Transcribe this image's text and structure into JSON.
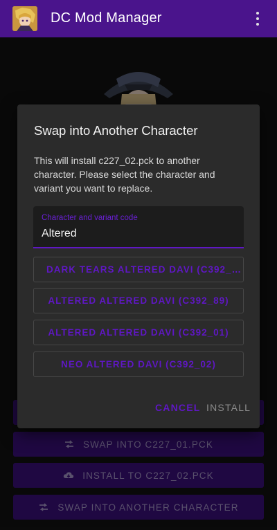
{
  "app": {
    "title": "DC Mod Manager"
  },
  "background_buttons": {
    "swap_into": "SWAP INTO C227_01.PCK",
    "install_to": "INSTALL TO C227_02.PCK",
    "swap_other": "SWAP INTO ANOTHER CHARACTER"
  },
  "dialog": {
    "title": "Swap into Another Character",
    "message": "This will install c227_02.pck to another character. Please select the character and variant you want to replace.",
    "field": {
      "label": "Character and variant code",
      "value": "Altered"
    },
    "options": [
      "DARK TEARS ALTERED DAVI (C392_…",
      "ALTERED ALTERED DAVI (C392_89)",
      "ALTERED ALTERED DAVI (C392_01)",
      "NEO ALTERED DAVI (C392_02)"
    ],
    "cancel_label": "CANCEL",
    "install_label": "INSTALL"
  },
  "colors": {
    "appbar": "#4a148c",
    "accent": "#5f17c4",
    "dialog_bg": "#2b2b2b"
  },
  "icons": {
    "swap": "swap-icon",
    "cloud_download": "cloud-download-icon",
    "overflow": "overflow-menu-icon"
  }
}
